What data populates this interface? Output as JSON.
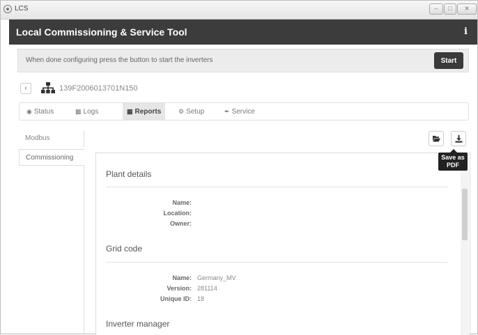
{
  "window": {
    "title": "LCS"
  },
  "app": {
    "title": "Local Commissioning & Service Tool",
    "info_label": "i"
  },
  "notice": {
    "text": "When done configuring press the button to start the inverters",
    "start_label": "Start"
  },
  "device": {
    "id": "139F2006013701N150"
  },
  "tabs": [
    {
      "label": "Status",
      "icon": "eye-icon"
    },
    {
      "label": "Logs",
      "icon": "book-icon"
    },
    {
      "label": "Reports",
      "icon": "file-icon"
    },
    {
      "label": "Setup",
      "icon": "cogs-icon"
    },
    {
      "label": "Service",
      "icon": "wrench-icon"
    }
  ],
  "sidebar": {
    "items": [
      {
        "label": "Modbus"
      },
      {
        "label": "Commissioning"
      }
    ]
  },
  "tooltip": {
    "line1": "Save as",
    "line2": "PDF"
  },
  "report": {
    "plant": {
      "title": "Plant details",
      "name_label": "Name:",
      "location_label": "Location:",
      "owner_label": "Owner:"
    },
    "grid": {
      "title": "Grid code",
      "name_label": "Name:",
      "name_value": "Germany_MV",
      "version_label": "Version:",
      "version_value": "281114",
      "uid_label": "Unique ID:",
      "uid_value": "18"
    },
    "inverter": {
      "title": "Inverter manager"
    }
  }
}
